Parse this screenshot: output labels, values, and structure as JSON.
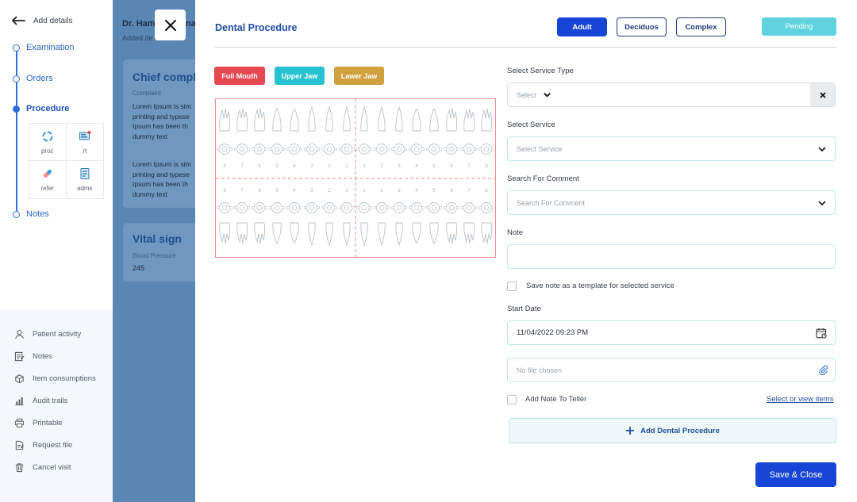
{
  "sidebar": {
    "back_label": "Add details",
    "steps": [
      {
        "label": "Examination"
      },
      {
        "label": "Orders"
      },
      {
        "label": "Procedure"
      },
      {
        "label": "Notes"
      }
    ],
    "sub_items": [
      {
        "label": "proc",
        "icon": "refresh-icon"
      },
      {
        "label": "rt",
        "icon": "monitor-icon"
      },
      {
        "label": "refer",
        "icon": "pill-icon"
      },
      {
        "label": "adms",
        "icon": "document-icon"
      }
    ],
    "menu": [
      {
        "label": "Patient activity",
        "icon": "user-icon"
      },
      {
        "label": "Notes",
        "icon": "note-icon"
      },
      {
        "label": "Item consumptions",
        "icon": "box-icon"
      },
      {
        "label": "Audit trails",
        "icon": "chart-icon"
      },
      {
        "label": "Printable",
        "icon": "printer-icon"
      },
      {
        "label": "Request file",
        "icon": "file-icon"
      },
      {
        "label": "Cancel visit",
        "icon": "trash-icon"
      }
    ]
  },
  "background_page": {
    "doctor": "Dr. Ham",
    "doctor_tail": "na",
    "added": "Added de",
    "chief_title": "Chief compl",
    "complaint_label": "Complaint",
    "para1": "Lorem Ipsum is sim\nprinting and typese\nIpsum has been th\ndummy text",
    "para2": "Lorem Ipsum is sim\nprinting and typese\nIpsum has been th\ndummy text",
    "vital_title": "Vital sign",
    "bp_label": "Blood Pressure",
    "bp_value": "245"
  },
  "modal": {
    "title": "Dental Procedure",
    "segments": [
      "Adult",
      "Deciduos",
      "Complex"
    ],
    "status": "Pending",
    "jaw_buttons": [
      "Full Mouth",
      "Upper Jaw",
      "Lawer Jaw"
    ],
    "tooth_numbers": [
      "8",
      "7",
      "6",
      "5",
      "4",
      "3",
      "2",
      "1",
      "1",
      "2",
      "3",
      "4",
      "5",
      "6",
      "7",
      "8"
    ],
    "form": {
      "service_type_label": "Select Service Type",
      "service_type_placeholder": "Select",
      "service_label": "Select Service",
      "service_placeholder": "Select Service",
      "comment_label": "Search For Comment",
      "comment_placeholder": "Search For Comment",
      "note_label": "Note",
      "note_value": "",
      "template_label": "Save note as a template for selected service",
      "start_date_label": "Start Date",
      "start_date_value": "11/04/2022 09:23 PM",
      "file_placeholder": "No file chosen",
      "teller_label": "Add Note To Teller",
      "view_items_link": "Select or view items"
    },
    "add_procedure_label": "Add Dental Procedure",
    "save_label": "Save & Close"
  },
  "colors": {
    "primary": "#1746d6",
    "full_mouth": "#e5484f",
    "upper_jaw": "#27c2cf",
    "lower_jaw": "#cfa03c",
    "pending": "#60d3de"
  }
}
